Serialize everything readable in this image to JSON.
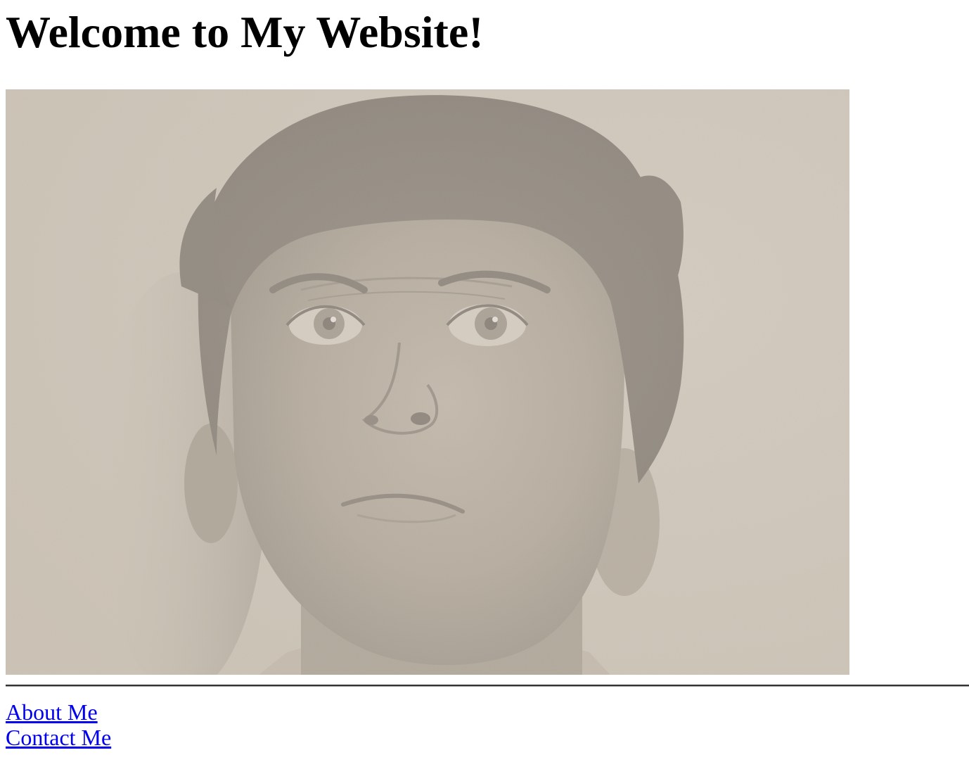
{
  "page": {
    "heading": "Welcome to My Website!"
  },
  "photo": {
    "subject": "sepia portrait photograph of a man with curly hair",
    "tone": "#d2c9bd"
  },
  "nav": {
    "links": [
      {
        "label": "About Me"
      },
      {
        "label": "Contact Me"
      }
    ]
  },
  "colors": {
    "link": "#0000ee",
    "text": "#000000",
    "background": "#ffffff",
    "rule": "#333333"
  }
}
